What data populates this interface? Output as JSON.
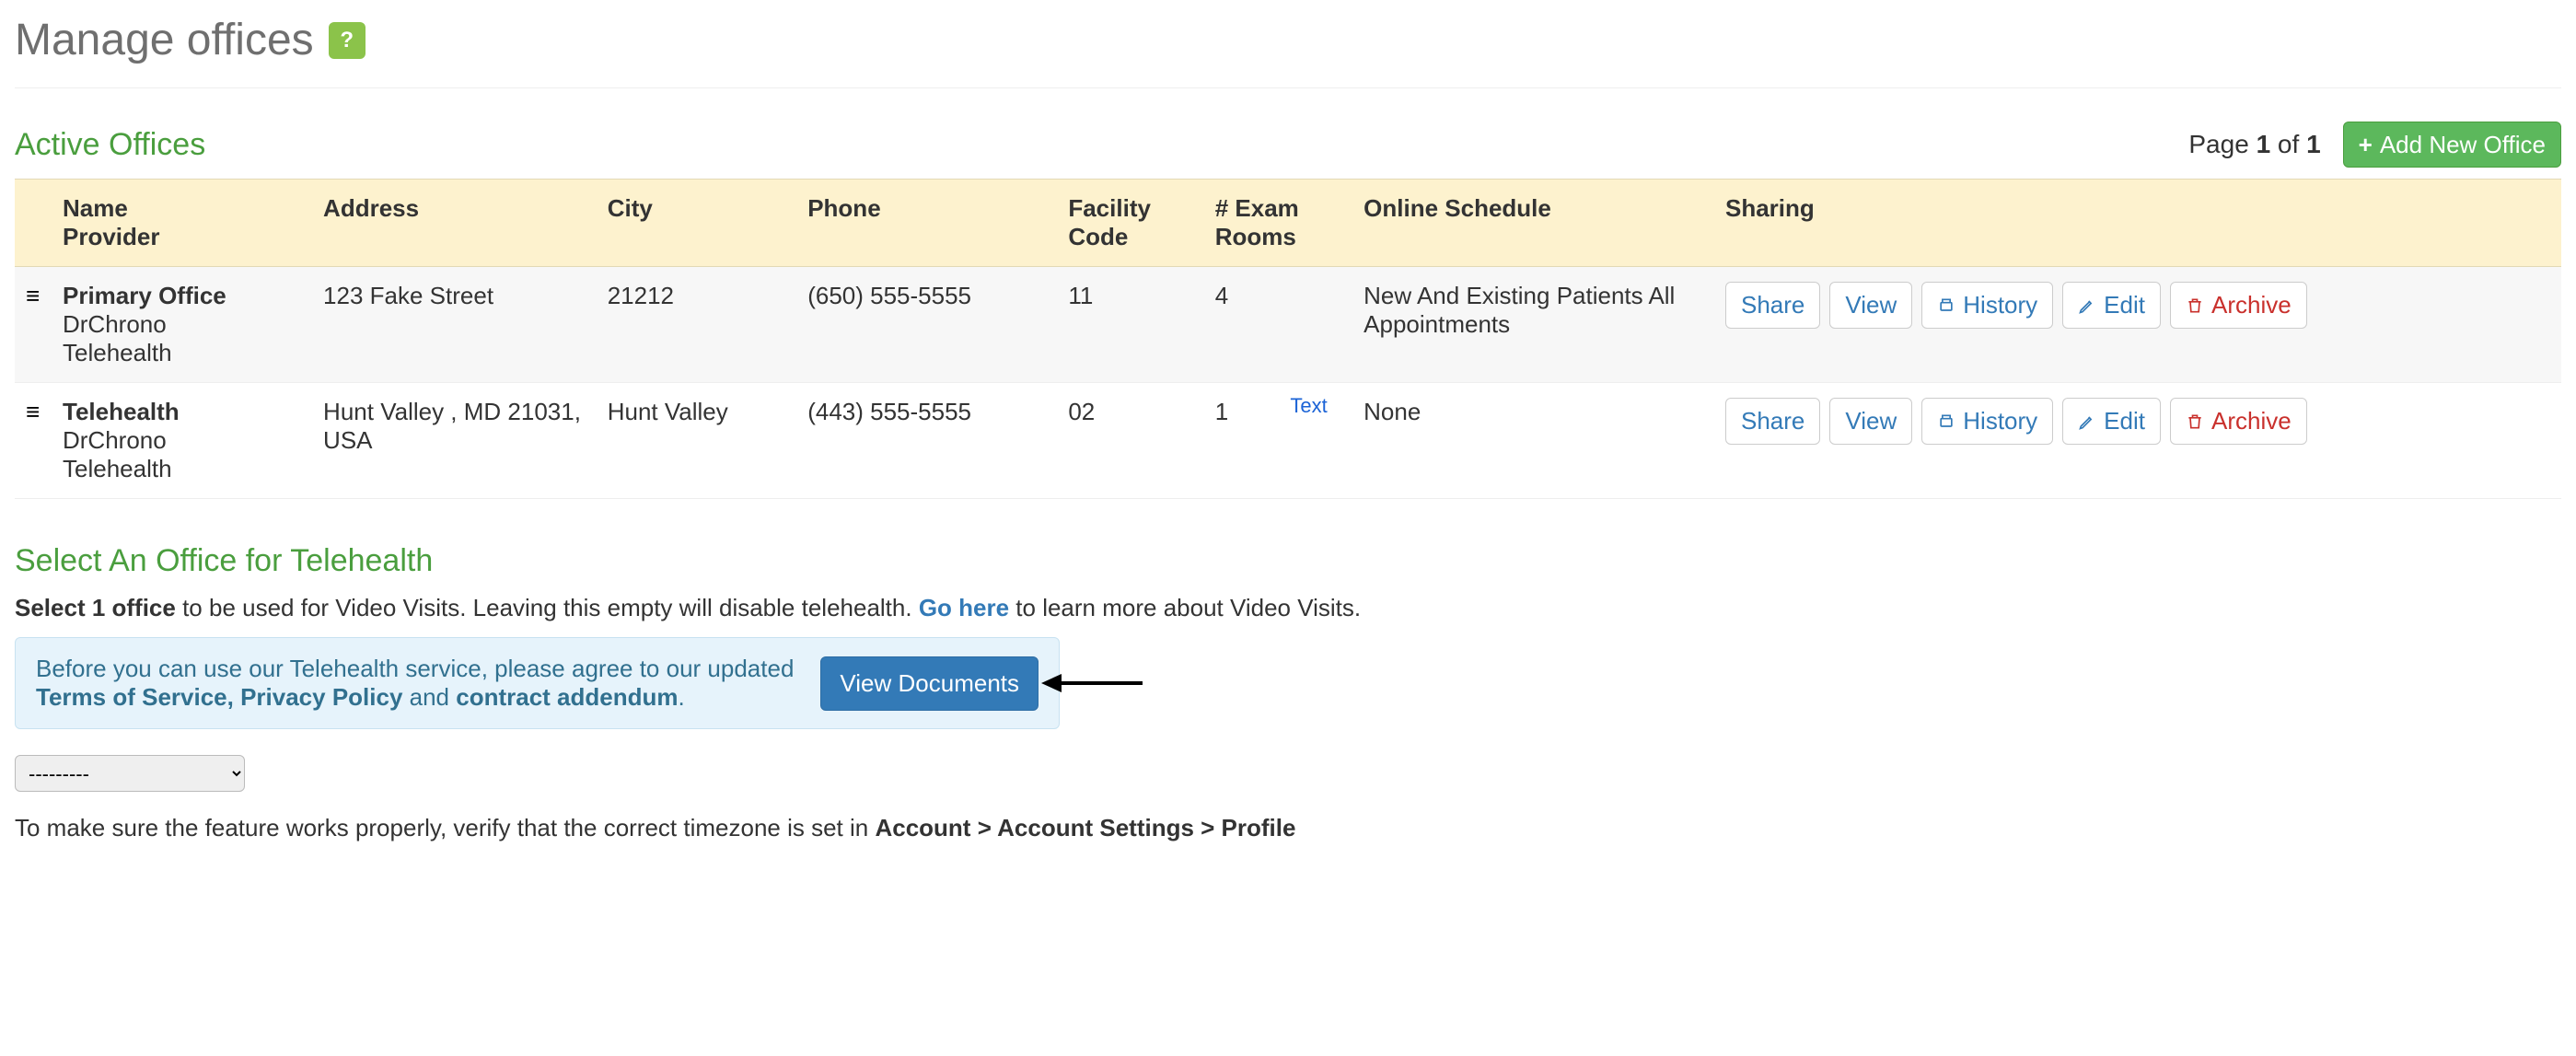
{
  "header": {
    "title": "Manage offices",
    "help_label": "?"
  },
  "active_section": {
    "title": "Active Offices",
    "page_word": "Page",
    "page_current": "1",
    "page_of": "of",
    "page_total": "1",
    "add_button": "Add New Office"
  },
  "table": {
    "headers": {
      "name_provider_l1": "Name",
      "name_provider_l2": "Provider",
      "address": "Address",
      "city": "City",
      "phone": "Phone",
      "facility_l1": "Facility",
      "facility_l2": "Code",
      "exam_l1": "# Exam",
      "exam_l2": "Rooms",
      "online_schedule": "Online Schedule",
      "sharing": "Sharing"
    },
    "rows": [
      {
        "name": "Primary Office",
        "provider_l1": "DrChrono",
        "provider_l2": "Telehealth",
        "address": "123 Fake Street",
        "city": "21212",
        "phone": "(650) 555-5555",
        "facility": "11",
        "exam_rooms": "4",
        "online_schedule": "New And Existing Patients All Appointments",
        "stray": ""
      },
      {
        "name": "Telehealth",
        "provider_l1": "DrChrono",
        "provider_l2": "Telehealth",
        "address": "Hunt Valley , MD 21031, USA",
        "city": "Hunt Valley",
        "phone": "(443) 555-5555",
        "facility": "02",
        "exam_rooms": "1",
        "online_schedule": "None",
        "stray": "Text"
      }
    ],
    "actions": {
      "share": "Share",
      "view": "View",
      "history": "History",
      "edit": "Edit",
      "archive": "Archive"
    }
  },
  "telehealth": {
    "title": "Select An Office for Telehealth",
    "instr_bold": "Select 1 office",
    "instr_rest_1": " to be used for Video Visits. Leaving this empty will disable telehealth. ",
    "instr_link": "Go here",
    "instr_rest_2": " to learn more about Video Visits.",
    "alert_pre": "Before you can use our Telehealth service, please agree to our updated ",
    "alert_bold1": "Terms of Service, Privacy Policy",
    "alert_mid": " and ",
    "alert_bold2": "contract addendum",
    "alert_post": ". ",
    "alert_button": "View Documents",
    "select_placeholder": "---------",
    "tz_pre": "To make sure the feature works properly, verify that the correct timezone is set in ",
    "tz_bold": "Account > Account Settings > Profile"
  }
}
